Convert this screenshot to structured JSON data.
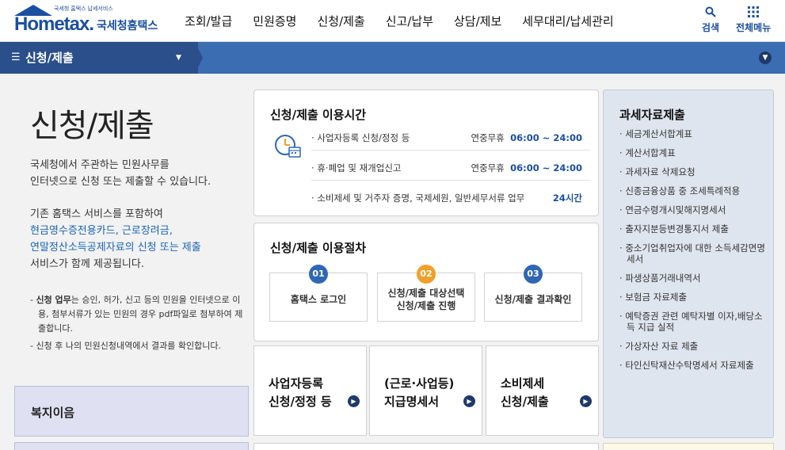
{
  "header": {
    "logo_word": "Hometax.",
    "logo_tag": "국세청 홈택스 납세서비스",
    "logo_kr": "국세청홈택스",
    "nav": [
      "조회/발급",
      "민원증명",
      "신청/제출",
      "신고/납부",
      "상담/제보",
      "세무대리/납세관리"
    ],
    "search_label": "검색",
    "all_menu_label": "전체메뉴",
    "brand_color": "#1a4fa0"
  },
  "location": {
    "current": "신청/제출"
  },
  "intro": {
    "title": "신청/제출",
    "p1_line1": "국세청에서 주관하는 민원사무를",
    "p1_line2": "인터넷으로 신청 또는 제출할 수 있습니다.",
    "p2_line1": "기존 홈택스 서비스를 포함하여",
    "p2_blue1": "현금영수증전용카드, 근로장려금,",
    "p2_blue2": "연말정산소득공제자료의 신청 또는 제출",
    "p2_line4": "서비스가 함께 제공됩니다.",
    "note1_bold": "신청 업무",
    "note1_rest": "는 승인, 허가, 신고 등의 민원을 인터넷으로 이용, 첨부서류가 있는 민원의 경우 pdf파일로 첨부하여 제출합니다.",
    "note2": "신청 후 나의 민원신청내역에서 결과를 확인합니다."
  },
  "side_box": {
    "label": "복지이음"
  },
  "hours": {
    "title": "신청/제출 이용시간",
    "rows": [
      {
        "label": "사업자등록 신청/정정 등",
        "prefix": "연중무휴",
        "time": "06:00 ~ 24:00"
      },
      {
        "label": "휴·폐업 및 재개업신고",
        "prefix": "연중무휴",
        "time": "06:00 ~ 24:00"
      },
      {
        "label": "소비제세 및 거주자 증명, 국제세원, 일반세무서류 업무",
        "prefix": "",
        "time": "24시간"
      }
    ]
  },
  "procedure": {
    "title": "신청/제출 이용절차",
    "steps": [
      {
        "num": "01",
        "line1": "홈택스 로그인",
        "line2": ""
      },
      {
        "num": "02",
        "line1": "신청/제출 대상선택",
        "line2": "신청/제출 진행"
      },
      {
        "num": "03",
        "line1": "신청/제출 결과확인",
        "line2": ""
      }
    ]
  },
  "tiles": [
    {
      "line1": "사업자등록",
      "line2": "신청/정정 등"
    },
    {
      "line1": "(근로·사업등)",
      "line2": "지급명세서"
    },
    {
      "line1": "소비제세",
      "line2": "신청/제출"
    }
  ],
  "right_panel": {
    "title": "과세자료제출",
    "items": [
      "세금계산서합계표",
      "계산서합계표",
      "과세자료 삭제요청",
      "신종금융상품 중 조세특례적용",
      "연금수령개시및해지명세서",
      "출자지분등변경통지서 제출",
      "중소기업취업자에 대한 소득세감면명세서",
      "파생상품거래내역서",
      "보험금 자료제출",
      "예탁증권 관련 예탁자별 이자,배당소득 지급 실적",
      "가상자산 자료 제출",
      "타인신탁재산수탁명세서 자료제출"
    ]
  }
}
